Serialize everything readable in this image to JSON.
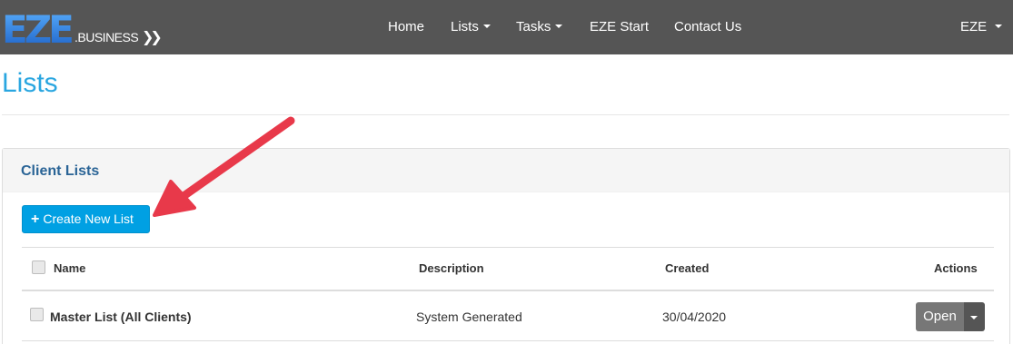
{
  "brand": {
    "logo_main": "EZE",
    "logo_sub": ".BUSINESS",
    "logo_arrows": "❯❯"
  },
  "nav": {
    "home": "Home",
    "lists": "Lists",
    "tasks": "Tasks",
    "eze_start": "EZE Start",
    "contact": "Contact Us",
    "user": "EZE"
  },
  "page": {
    "title": "Lists"
  },
  "panel": {
    "title": "Client Lists",
    "create_button": "Create New List",
    "create_icon": "+"
  },
  "table": {
    "headers": {
      "name": "Name",
      "description": "Description",
      "created": "Created",
      "actions": "Actions"
    },
    "rows": [
      {
        "name": "Master List (All Clients)",
        "description": "System Generated",
        "created": "30/04/2020",
        "action": "Open"
      }
    ]
  },
  "colors": {
    "navbar": "#555555",
    "title": "#2aa6e0",
    "button": "#00a0e3",
    "annotation_arrow": "#e8394a"
  }
}
